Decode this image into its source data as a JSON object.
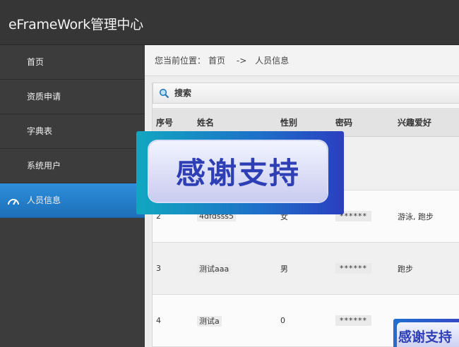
{
  "app": {
    "title": "eFrameWork管理中心"
  },
  "sidebar": {
    "items": [
      {
        "label": "首页"
      },
      {
        "label": "资质申请"
      },
      {
        "label": "字典表"
      },
      {
        "label": "系统用户"
      },
      {
        "label": "人员信息",
        "active": true,
        "icon": "dashboard-icon"
      }
    ]
  },
  "breadcrumb": {
    "prefix": "您当前位置：",
    "home": "首页",
    "sep": "->",
    "current": "人员信息"
  },
  "search": {
    "label": "搜索",
    "icon": "search-icon"
  },
  "table": {
    "headers": [
      "序号",
      "姓名",
      "性别",
      "密码",
      "兴趣爱好"
    ],
    "rows": [
      {
        "no": "",
        "name": "",
        "sex": "",
        "pwd": "",
        "hobby": ""
      },
      {
        "no": "2",
        "name": "4dfdsss5",
        "sex": "女",
        "pwd": "******",
        "hobby": "游泳, 跑步"
      },
      {
        "no": "3",
        "name": "测试aaa",
        "sex": "男",
        "pwd": "******",
        "hobby": "跑步"
      },
      {
        "no": "4",
        "name": "测试a",
        "sex": "0",
        "pwd": "******",
        "hobby": ""
      }
    ]
  },
  "overlay": {
    "text": "感谢支持",
    "text_small": "感谢支持"
  },
  "colors": {
    "accent": "#1d6fb8",
    "banner": "#2e3fb5"
  }
}
